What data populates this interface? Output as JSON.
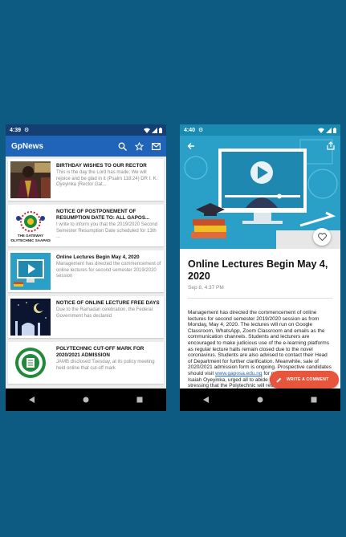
{
  "left_phone": {
    "status_time": "4:39",
    "app_title": "GpNews",
    "icons": {
      "search": "search-icon",
      "favorites": "star-icon",
      "mail": "mail-icon"
    },
    "articles": [
      {
        "title": "BIRTHDAY WISHES TO OUR RECTOR",
        "body": "This is the day the Lord has made; We will rejoice and be glad in it (Psalm 118:24) DR I. K. Oyeyinka (Rector Gat..."
      },
      {
        "title": "NOTICE OF POSTPONEMENT OF RESUMPTION DATE TO: ALL GAPOS...",
        "body": "I write to inform you that the 2019/2020 Second Semester Resumption Date scheduled for 13th ..."
      },
      {
        "title": "Online Lectures Begin May 4, 2020",
        "body": "Management has directed the commencement of online lectures for second semester 2019/2020 session"
      },
      {
        "title": "NOTICE OF ONLINE LECTURE FREE DAYS",
        "body": "Due to the Ramadan celebration, the Federal Government has declared"
      },
      {
        "title": "POLYTECHNIC CUT-OFF MARK FOR 2020/2021 ADMISSION",
        "body": "JAMB disclosed Tuesday, at its policy meeting held online that cut-off mark"
      }
    ],
    "logo_text": "THE GATEWAY POLYTECHNIC SAAPADE"
  },
  "right_phone": {
    "status_time": "4:40",
    "article_title": "Online Lectures Begin May 4, 2020",
    "article_date": "Sep 8, 4:37 PM",
    "body_before_link": "Management has directed the commencement of online lectures for second semester 2019/2020 session as from Monday, May 4, 2020. The lectures will run on Google Classroom, WhatsApp, Zoom Classroom and emails as the communication channels. Students and lecturers are encouraged to make judicious use of the e-learning platforms as regular lecture halls remain closed due to the novel coronavirus. Students are also advised to contact their Head of Department for further clarification. Meanwhile, sale of 2020/2021 admission form is ongoing. Prospective candidates should visit ",
    "body_link": "www.gaposa.edu.ng",
    "body_after_link": " for more details. Rector, Dr. Isaiah Oyeyinka, urged all to abide by the development stressing that the Polytechnic will resume when directed by the Ogun State Government. Adedayo",
    "fab_label": "WRITE A COMMENT"
  },
  "colors": {
    "background": "#0d5a82",
    "status_bar": "#153f73",
    "app_bar": "#1f64b8",
    "fab": "#e8553d",
    "hero": "#2aa0c8"
  }
}
